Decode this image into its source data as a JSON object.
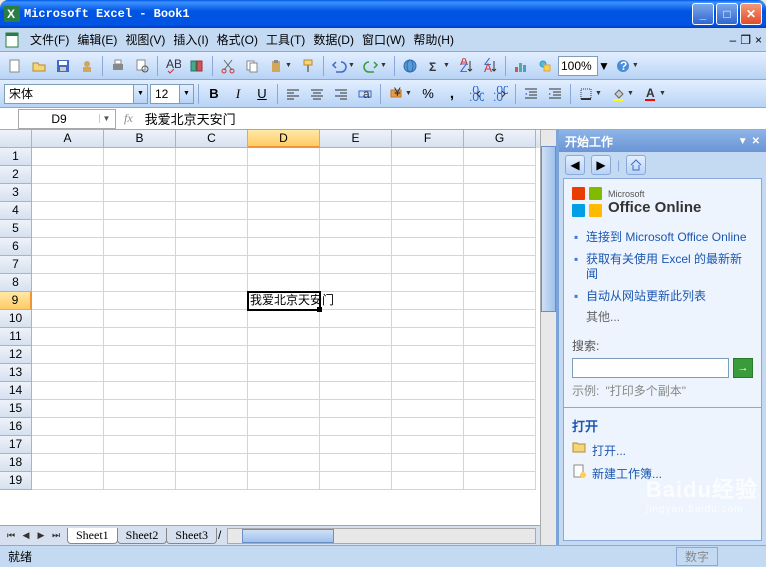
{
  "window": {
    "title": "Microsoft Excel - Book1"
  },
  "menu": {
    "items": [
      "文件(F)",
      "编辑(E)",
      "视图(V)",
      "插入(I)",
      "格式(O)",
      "工具(T)",
      "数据(D)",
      "窗口(W)",
      "帮助(H)"
    ]
  },
  "format_toolbar": {
    "font_name": "宋体",
    "font_size": "12",
    "zoom": "100%"
  },
  "formula_bar": {
    "name_box": "D9",
    "formula": "我爱北京天安门"
  },
  "grid": {
    "columns": [
      "A",
      "B",
      "C",
      "D",
      "E",
      "F",
      "G"
    ],
    "active_col_index": 3,
    "active_row": 9,
    "row_count": 19,
    "cells": {
      "D9": "我爱北京天安门"
    }
  },
  "sheets": {
    "tabs": [
      "Sheet1",
      "Sheet2",
      "Sheet3"
    ],
    "active": 0
  },
  "task_pane": {
    "title": "开始工作",
    "office_online_small": "Microsoft",
    "office_online_big": "Office Online",
    "links": [
      "连接到 Microsoft Office Online",
      "获取有关使用 Excel 的最新新闻",
      "自动从网站更新此列表"
    ],
    "more": "其他...",
    "search_label": "搜索:",
    "search_example_label": "示例:",
    "search_example_value": "\"打印多个副本\"",
    "open_section": "打开",
    "open_link": "打开...",
    "new_link": "新建工作簿..."
  },
  "statusbar": {
    "ready": "就绪",
    "mode": "数字"
  },
  "watermark": {
    "brand": "Baidu经验",
    "url": "jingyan.baidu.com"
  }
}
